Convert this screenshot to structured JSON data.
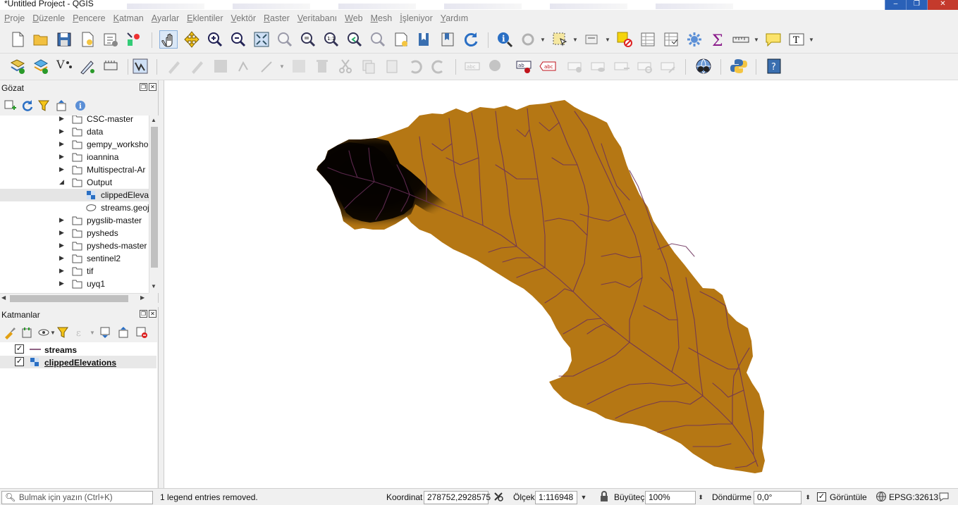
{
  "window": {
    "title": "*Untitled Project - QGIS"
  },
  "menu": [
    "Proje",
    "Düzenle",
    "Pencere",
    "Katman",
    "Ayarlar",
    "Eklentiler",
    "Vektör",
    "Raster",
    "Veritabanı",
    "Web",
    "Mesh",
    "İşleniyor",
    "Yardım"
  ],
  "browser_panel": {
    "title": "Gözat",
    "items": [
      {
        "label": "CSC-master",
        "type": "folder",
        "expanded": false
      },
      {
        "label": "data",
        "type": "folder",
        "expanded": false
      },
      {
        "label": "gempy_worksho",
        "type": "folder",
        "expanded": false
      },
      {
        "label": "ioannina",
        "type": "folder",
        "expanded": false
      },
      {
        "label": "Multispectral-Ar",
        "type": "folder",
        "expanded": false
      },
      {
        "label": "Output",
        "type": "folder",
        "expanded": true
      },
      {
        "label": "clippedElevat",
        "type": "raster",
        "child": true,
        "selected": true
      },
      {
        "label": "streams.geoj",
        "type": "vector",
        "child": true
      },
      {
        "label": "pygslib-master",
        "type": "folder",
        "expanded": false
      },
      {
        "label": "pysheds",
        "type": "folder",
        "expanded": false
      },
      {
        "label": "pysheds-master",
        "type": "folder",
        "expanded": false
      },
      {
        "label": "sentinel2",
        "type": "folder",
        "expanded": false
      },
      {
        "label": "tif",
        "type": "folder",
        "expanded": false
      },
      {
        "label": "uyq1",
        "type": "folder",
        "expanded": false
      }
    ]
  },
  "layers_panel": {
    "title": "Katmanlar",
    "layers": [
      {
        "name": "streams",
        "checked": true,
        "type": "line"
      },
      {
        "name": "clippedElevations",
        "checked": true,
        "type": "raster"
      }
    ]
  },
  "map": {
    "background": "#ffffff",
    "watershed_color": "#b57714",
    "high_color": "#000000",
    "stream_color": "#6b2f5a"
  },
  "status": {
    "search_placeholder": "Bulmak için yazın (Ctrl+K)",
    "message": "1 legend entries removed.",
    "coord_label": "Koordinat",
    "coord_value": "278752,2928575",
    "scale_label": "Ölçek",
    "scale_value": "1:116948",
    "magnifier_label": "Büyüteç",
    "magnifier_value": "100%",
    "rotation_label": "Döndürme",
    "rotation_value": "0,0°",
    "render_label": "Görüntüle",
    "crs": "EPSG:32613"
  }
}
